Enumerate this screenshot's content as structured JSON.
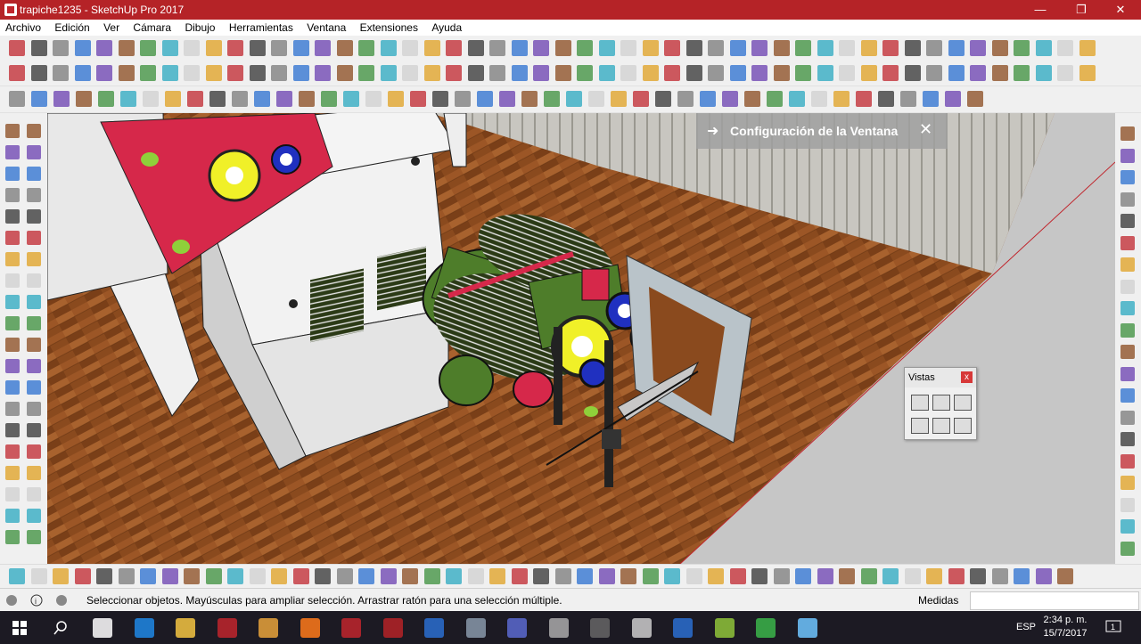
{
  "window": {
    "title": "trapiche1235 - SketchUp Pro 2017",
    "minimize": "—",
    "maximize": "❐",
    "close": "✕"
  },
  "menu": [
    "Archivo",
    "Edición",
    "Ver",
    "Cámara",
    "Dibujo",
    "Herramientas",
    "Ventana",
    "Extensiones",
    "Ayuda"
  ],
  "notice": {
    "arrow": "➜",
    "text": "Configuración de la Ventana",
    "close": "✕"
  },
  "vistas": {
    "title": "Vistas",
    "close": "x"
  },
  "status": {
    "message": "Seleccionar objetos. Mayúsculas para ampliar selección. Arrastrar ratón para una selección múltiple.",
    "medidas_label": "Medidas"
  },
  "taskbar": {
    "time": "2:34 p. m.",
    "date": "15/7/2017",
    "lang": "ESP"
  },
  "colors": {
    "title_bar": "#b52327",
    "floor": "#8a4a1e",
    "machine_green": "#4e7d2a",
    "gear_yellow": "#f0f028",
    "gear_blue": "#2030c0",
    "panel_red": "#d6284a"
  }
}
